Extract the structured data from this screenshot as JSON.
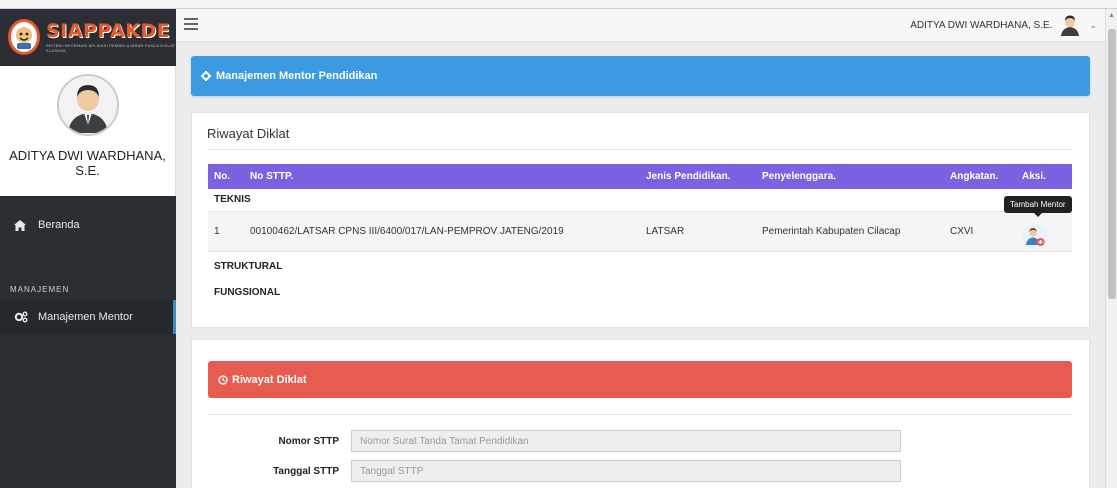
{
  "brand": {
    "name": "SIAPPAKDE",
    "subtitle": "SISTEM INFORMASI APLIKASI PEMBELAJARAN PASCA DIKLAT KLASIKAL"
  },
  "profile": {
    "name": "ADITYA DWI WARDHANA, S.E."
  },
  "nav": {
    "beranda": "Beranda",
    "section_label": "MANAJEMEN",
    "manajemen_mentor": "Manajemen Mentor"
  },
  "header": {
    "user_name": "ADITYA DWI WARDHANA, S.E."
  },
  "page": {
    "title": "Manajemen Mentor Pendidikan"
  },
  "riwayat": {
    "title": "Riwayat Diklat",
    "columns": [
      "No.",
      "No STTP.",
      "Jenis Pendidikan.",
      "Penyelenggara.",
      "Angkatan.",
      "Aksi."
    ],
    "groups": [
      {
        "name": "TEKNIS",
        "rows": [
          {
            "no": "1",
            "no_sttp": "00100462/LATSAR CPNS III/6400/017/LAN-PEMPROV JATENG/2019",
            "jenis": "LATSAR",
            "penyelenggara": "Pemerintah Kabupaten Cilacap",
            "angkatan": "CXVI"
          }
        ]
      },
      {
        "name": "STRUKTURAL",
        "rows": []
      },
      {
        "name": "FUNGSIONAL",
        "rows": []
      }
    ],
    "tooltip": "Tambah Mentor"
  },
  "form": {
    "alert_title": "Riwayat Diklat",
    "nomor_sttp_label": "Nomor STTP",
    "nomor_sttp_placeholder": "Nomor Surat Tanda Tamat Pendidikan",
    "tanggal_sttp_label": "Tanggal STTP",
    "tanggal_sttp_placeholder": "Tanggal STTP"
  },
  "colors": {
    "title_bar": "#3c9be0",
    "table_header": "#7b62e0",
    "alert": "#e75c50",
    "sidebar": "#2b2f33",
    "brand": "#e55a2a"
  },
  "icons": {
    "brand": "mascot-logo-icon",
    "menu": "hamburger-icon",
    "beranda": "home-icon",
    "mentor": "gears-icon",
    "title": "gear-icon",
    "alert": "clock-icon",
    "aksi": "add-user-icon"
  }
}
